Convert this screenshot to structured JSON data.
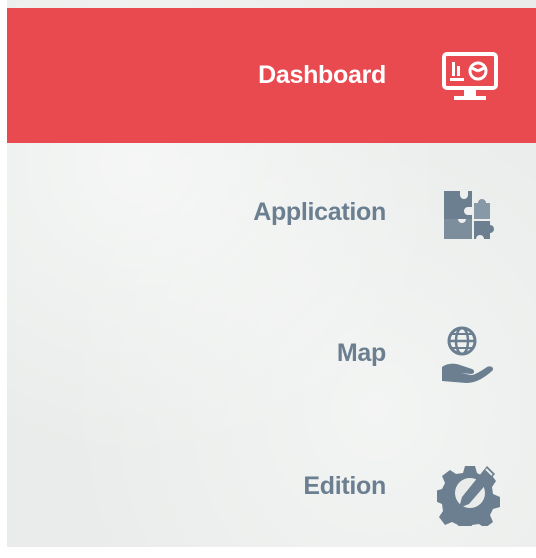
{
  "nav": {
    "items": [
      {
        "label": "Dashboard",
        "icon": "dashboard-monitor-icon",
        "active": true
      },
      {
        "label": "Application",
        "icon": "puzzle-icon",
        "active": false
      },
      {
        "label": "Map",
        "icon": "globe-hand-icon",
        "active": false
      },
      {
        "label": "Edition",
        "icon": "gear-pencil-icon",
        "active": false
      }
    ]
  },
  "colors": {
    "active_bg": "#e84a50",
    "active_text": "#ffffff",
    "inactive_text": "#6b7f90",
    "panel_bg": "#e9ecea"
  }
}
